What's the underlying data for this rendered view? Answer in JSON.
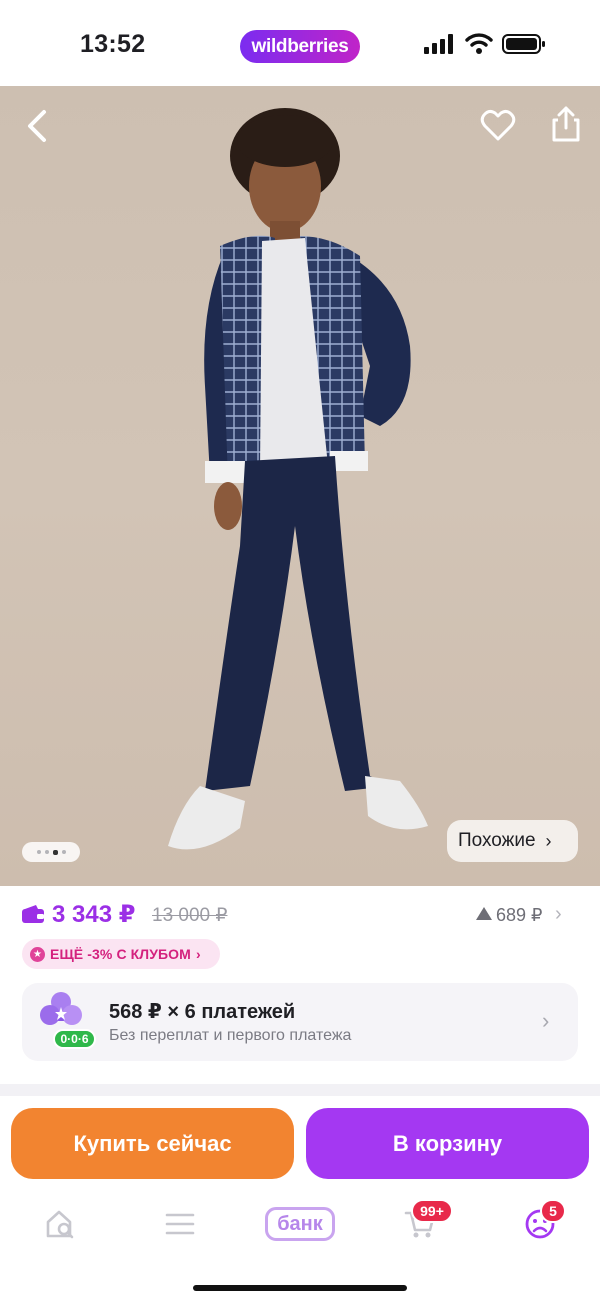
{
  "status_bar": {
    "time": "13:52",
    "brand": "wildberries"
  },
  "product_image": {
    "similar_label": "Похожие",
    "pager": {
      "count": 4,
      "active_index": 2
    }
  },
  "price": {
    "current": "3 343 ₽",
    "old": "13 000 ₽",
    "delta": "689 ₽"
  },
  "club_promo": {
    "label": "ЕЩЁ -3% С КЛУБОМ"
  },
  "installment": {
    "title": "568 ₽ × 6 платежей",
    "subtitle": "Без переплат и первого платежа",
    "badge": "0·0·6"
  },
  "actions": {
    "buy_now": "Купить сейчас",
    "add_to_cart": "В корзину"
  },
  "tab_bar": {
    "bank_label": "банк",
    "cart_badge": "99+",
    "profile_badge": "5"
  },
  "colors": {
    "accent": "#a438f2",
    "buy_button": "#f28430",
    "price": "#9b2fe6",
    "badge_red": "#e8294a",
    "installment_green": "#2fb84a"
  }
}
